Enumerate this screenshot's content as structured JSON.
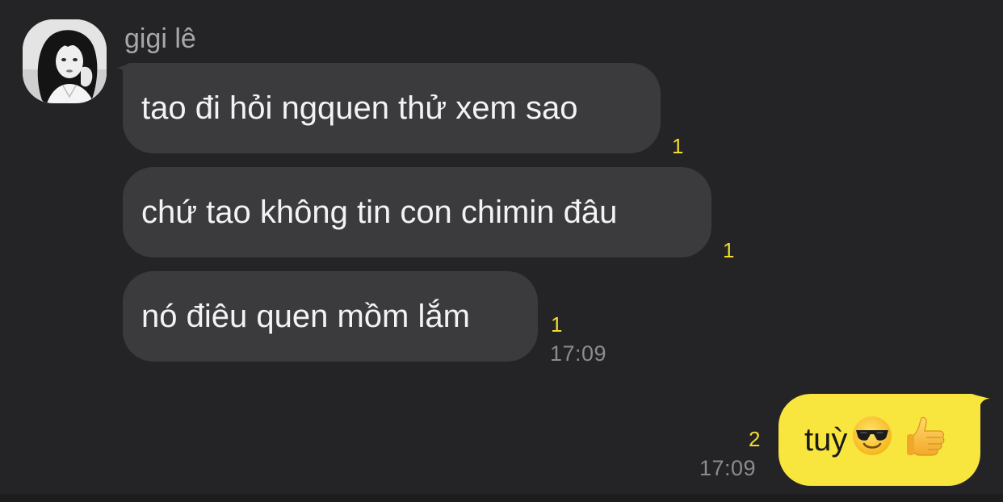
{
  "contact": {
    "name": "gigi lê"
  },
  "messages": [
    {
      "text": "tao đi hỏi ngquen thử xem sao",
      "unread": "1"
    },
    {
      "text": "chứ tao không tin con chimin đâu",
      "unread": "1"
    },
    {
      "text": "nó điêu quen mồm lắm",
      "unread": "1",
      "time": "17:09"
    }
  ],
  "my_message": {
    "text": "tuỳ",
    "emojis": [
      "smiling-face-with-sunglasses",
      "thumbs-up"
    ],
    "unread": "2",
    "time": "17:09"
  },
  "colors": {
    "background": "#242426",
    "incoming_bubble": "#3b3b3e",
    "outgoing_bubble": "#f8e53e",
    "unread_count": "#f2dc2d"
  }
}
